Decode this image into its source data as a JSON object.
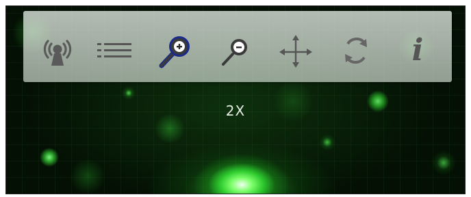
{
  "toolbar": {
    "tools": [
      {
        "name": "broadcast-icon",
        "label": ""
      },
      {
        "name": "list-icon",
        "label": ""
      },
      {
        "name": "zoom-in-icon",
        "label": "",
        "active": true
      },
      {
        "name": "zoom-out-icon",
        "label": ""
      },
      {
        "name": "move-icon",
        "label": ""
      },
      {
        "name": "rotate-icon",
        "label": ""
      },
      {
        "name": "info-icon",
        "label": "i"
      }
    ]
  },
  "viewer": {
    "zoom_label": "2X"
  },
  "colors": {
    "icon_gray": "#555555",
    "active_blue": "#1a2a8c",
    "label_text": "#e6ece6"
  }
}
